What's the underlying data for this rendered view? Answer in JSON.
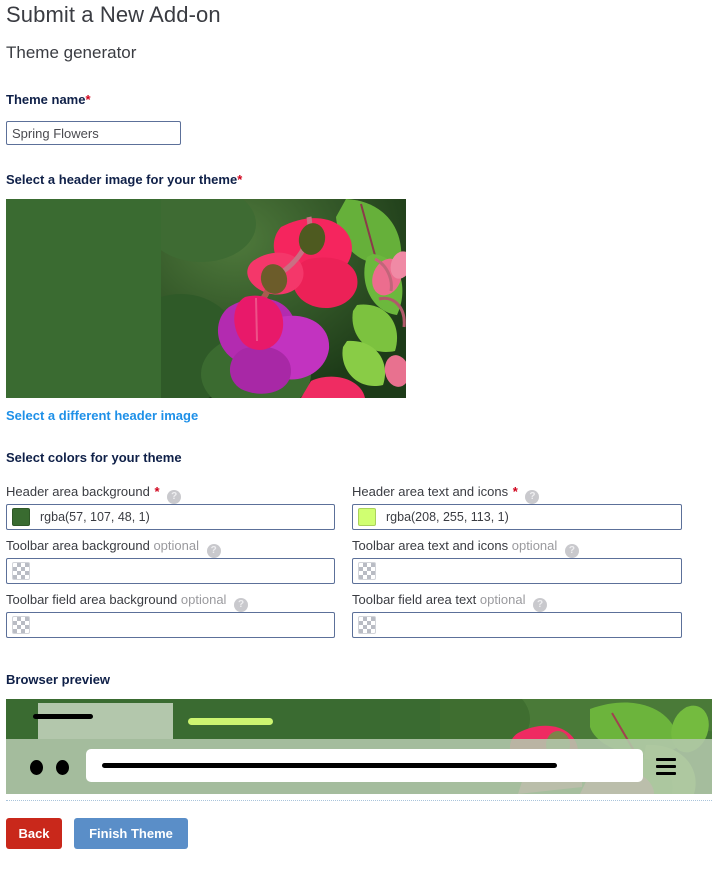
{
  "page": {
    "title": "Submit a New Add-on",
    "subtitle": "Theme generator"
  },
  "theme_name": {
    "label": "Theme name",
    "required_marker": "*",
    "value": "Spring Flowers",
    "placeholder": "Spring Flowers"
  },
  "header_image": {
    "label": "Select a header image for your theme",
    "required_marker": "*",
    "change_link": "Select a different header image",
    "solid_fill_color": "#3a6b31",
    "description": "Pink and magenta fuchsia flowers with green leaves"
  },
  "colors": {
    "section_label": "Select colors for your theme",
    "help_icon": "question-mark-icon",
    "optional_text": "optional",
    "required_marker": "*",
    "fields": [
      {
        "id": "header-area-background",
        "label": "Header area background",
        "required": true,
        "optional": false,
        "value": "rgba(57, 107, 48, 1)",
        "swatch": "#396b30",
        "transparent": false,
        "column": "left"
      },
      {
        "id": "toolbar-area-background",
        "label": "Toolbar area background",
        "required": false,
        "optional": true,
        "value": "",
        "swatch": "",
        "transparent": true,
        "column": "left"
      },
      {
        "id": "toolbar-field-area-background",
        "label": "Toolbar field area background",
        "required": false,
        "optional": true,
        "value": "",
        "swatch": "",
        "transparent": true,
        "column": "left"
      },
      {
        "id": "header-area-text-and-icons",
        "label": "Header area text and icons",
        "required": true,
        "optional": false,
        "value": "rgba(208, 255, 113, 1)",
        "swatch": "#d0ff71",
        "transparent": false,
        "column": "right"
      },
      {
        "id": "toolbar-area-text-and-icons",
        "label": "Toolbar area text and icons",
        "required": false,
        "optional": true,
        "value": "",
        "swatch": "",
        "transparent": true,
        "column": "right"
      },
      {
        "id": "toolbar-field-area-text",
        "label": "Toolbar field area text",
        "required": false,
        "optional": true,
        "value": "",
        "swatch": "",
        "transparent": true,
        "column": "right"
      }
    ]
  },
  "preview": {
    "label": "Browser preview",
    "tab_accent_color": "#cdf571",
    "toolbar_color": "#b3c7ac",
    "header_color": "#3a6b31"
  },
  "buttons": {
    "back": "Back",
    "finish": "Finish Theme",
    "back_color": "#c9281b",
    "finish_color": "#5a8ec8"
  }
}
